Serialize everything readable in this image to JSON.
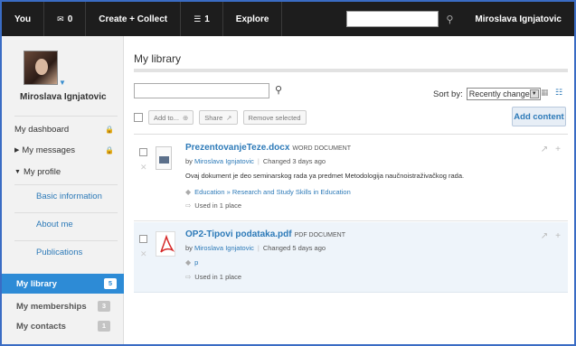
{
  "topbar": {
    "you": "You",
    "messages_count": "0",
    "create_collect": "Create + Collect",
    "stack_count": "1",
    "explore": "Explore",
    "search_placeholder": "",
    "user_name": "Miroslava Ignjatovic"
  },
  "sidebar": {
    "user_name": "Miroslava Ignjatovic",
    "items": {
      "dashboard": "My dashboard",
      "messages": "My messages",
      "profile": "My profile",
      "basic_information": "Basic information",
      "about_me": "About me",
      "publications": "Publications",
      "library": "My library",
      "library_count": "5",
      "memberships": "My memberships",
      "memberships_count": "3",
      "contacts": "My contacts",
      "contacts_count": "1"
    }
  },
  "main": {
    "title": "My library",
    "search_value": "",
    "sort_label": "Sort by:",
    "sort_value": "Recently changed",
    "toolbar": {
      "add_to": "Add to...",
      "share": "Share",
      "remove_selected": "Remove selected",
      "add_content": "Add content"
    },
    "items": [
      {
        "name": "PrezentovanjeTeze.docx",
        "type": "WORD DOCUMENT",
        "by": "by",
        "author": "Miroslava Ignjatovic",
        "changed": "Changed 3 days ago",
        "description": "Ovaj dokument je deo seminarskog rada ya predmet Metodologija naučnoistraživačkog rada.",
        "tags": "Education » Research and Study Skills in Education",
        "used": "Used in 1 place"
      },
      {
        "name": "OP2-Tipovi podataka.pdf",
        "type": "PDF DOCUMENT",
        "by": "by",
        "author": "Miroslava Ignjatovic",
        "changed": "Changed 5 days ago",
        "tags": "p",
        "used": "Used in 1 place"
      }
    ]
  },
  "colors": {
    "accent": "#2d8bd6",
    "topbar": "#1d1d1d",
    "frame": "#3a6cc4",
    "link": "#2d7ab8"
  }
}
